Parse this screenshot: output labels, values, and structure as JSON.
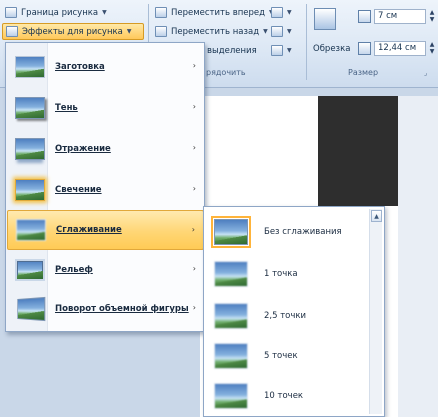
{
  "ribbon": {
    "border_btn": "Граница рисунка",
    "effects_btn": "Эффекты для рисунка",
    "bring_forward_btn": "Переместить вперед",
    "send_backward_btn": "Переместить назад",
    "selection_pane_btn": "выделения",
    "arrange_label": "рядочить",
    "crop_label": "Обрезка",
    "height_value": "7 см",
    "width_value": "12,44 см",
    "size_label": "Размер"
  },
  "effects_menu": {
    "items": [
      {
        "label": "Заготовка",
        "icon": "preset-thumb-icon"
      },
      {
        "label": "Тень",
        "icon": "shadow-thumb-icon"
      },
      {
        "label": "Отражение",
        "icon": "reflection-thumb-icon"
      },
      {
        "label": "Свечение",
        "icon": "glow-thumb-icon"
      },
      {
        "label": "Сглаживание",
        "icon": "soft-edges-thumb-icon"
      },
      {
        "label": "Рельеф",
        "icon": "bevel-thumb-icon"
      },
      {
        "label": "Поворот объемной фигуры",
        "icon": "3d-rotation-thumb-icon"
      }
    ],
    "highlighted_item": "Сглаживание"
  },
  "soft_edges_submenu": {
    "items": [
      {
        "label": "Без сглаживания"
      },
      {
        "label": "1 точка"
      },
      {
        "label": "2,5 точки"
      },
      {
        "label": "5 точек"
      },
      {
        "label": "10 точек"
      }
    ],
    "selected_item": "Без сглаживания"
  },
  "colors": {
    "highlight": "#ffd675",
    "ribbon_bg": "#dde8f5",
    "dark_shape": "#2e2e2e"
  }
}
